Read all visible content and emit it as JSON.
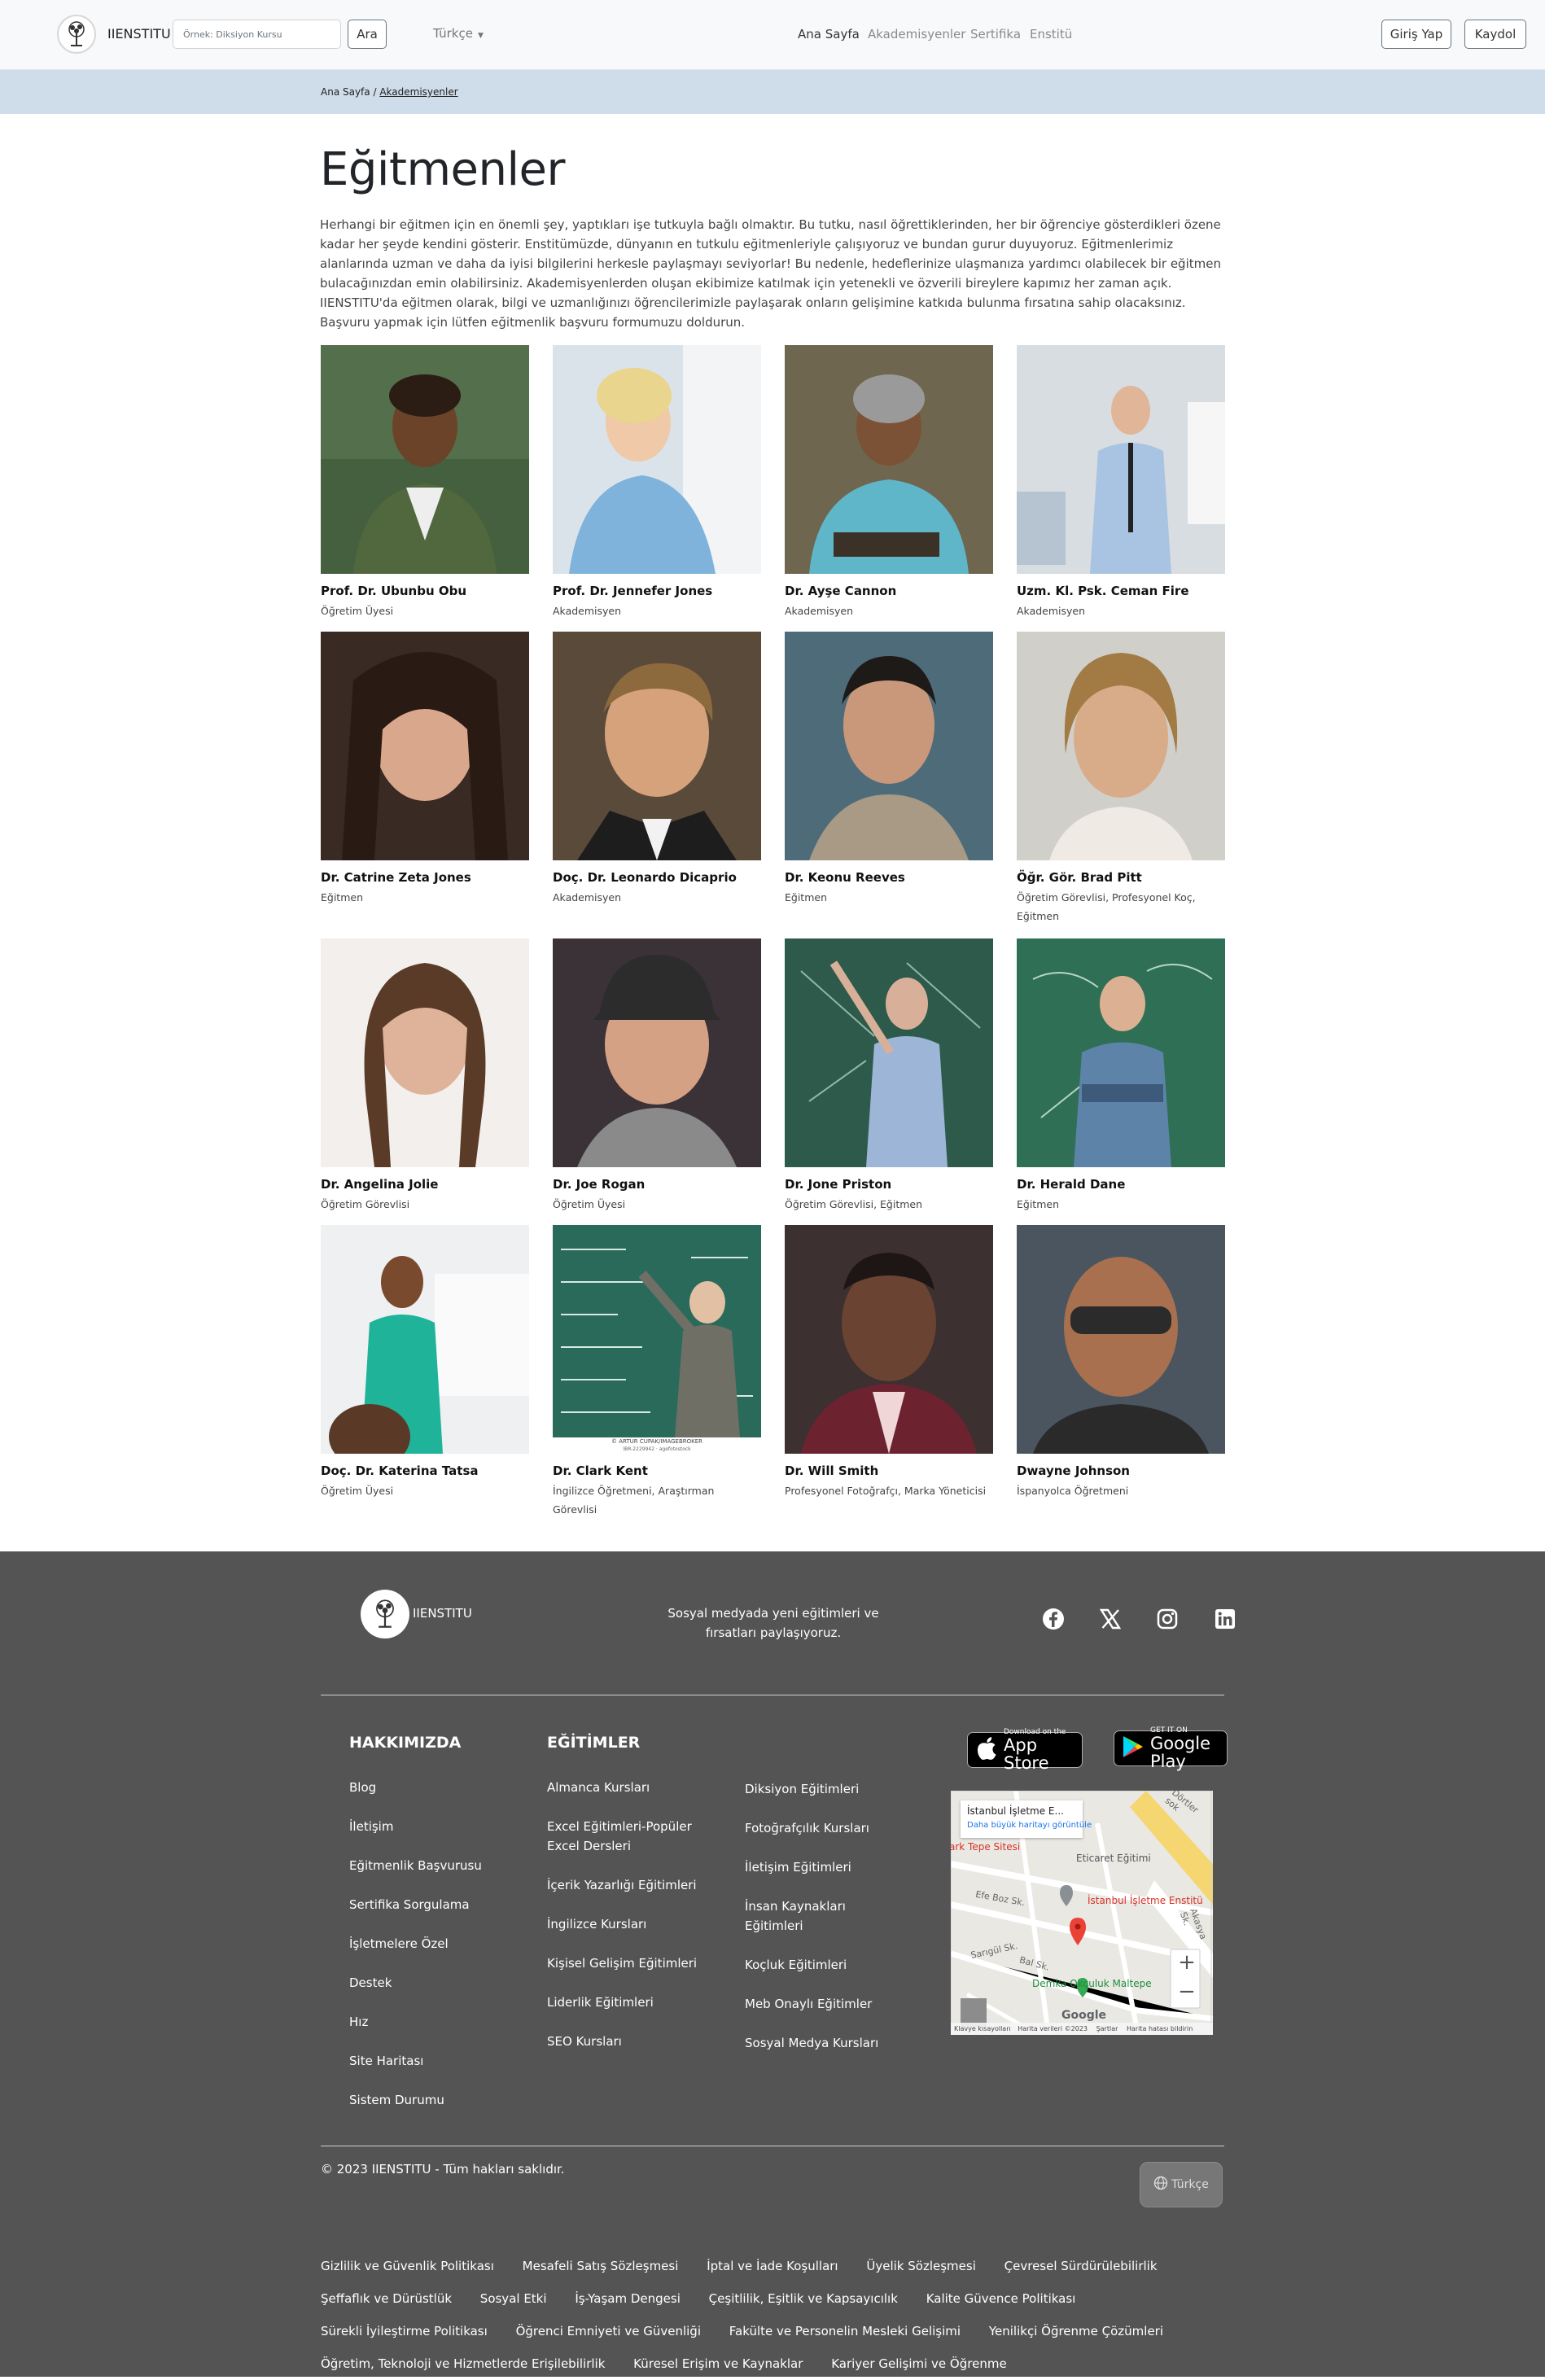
{
  "header": {
    "brand": "IIENSTITU",
    "search_placeholder": "Örnek: Diksiyon Kursu",
    "search_button": "Ara",
    "language": "Türkçe",
    "nav": [
      "Ana Sayfa",
      "Akademisyenler",
      "Sertifika",
      "Enstitü"
    ],
    "login": "Giriş Yap",
    "register": "Kaydol"
  },
  "breadcrumb": {
    "home": "Ana Sayfa",
    "separator": "/",
    "current": "Akademisyenler"
  },
  "page": {
    "title": "Eğitmenler",
    "intro": "Herhangi bir eğitmen için en önemli şey, yaptıkları işe tutkuyla bağlı olmaktır. Bu tutku, nasıl öğrettiklerinden, her bir öğrenciye gösterdikleri özene kadar her şeyde kendini gösterir. Enstitümüzde, dünyanın en tutkulu eğitmenleriyle çalışıyoruz ve bundan gurur duyuyoruz. Eğitmenlerimiz alanlarında uzman ve daha da iyisi bilgilerini herkesle paylaşmayı seviyorlar! Bu nedenle, hedeflerinize ulaşmanıza yardımcı olabilecek bir eğitmen bulacağınızdan emin olabilirsiniz. Akademisyenlerden oluşan ekibimize katılmak için yetenekli ve özverili bireylere kapımız her zaman açık. IIENSTITU'da eğitmen olarak, bilgi ve uzmanlığınızı öğrencilerimizle paylaşarak onların gelişimine katkıda bulunma fırsatına sahip olacaksınız. Başvuru yapmak için lütfen eğitmenlik başvuru formumuzu doldurun."
  },
  "instructors": [
    {
      "name": "Prof. Dr. Ubunbu Obu",
      "role": "Öğretim Üyesi"
    },
    {
      "name": "Prof. Dr. Jennefer Jones",
      "role": "Akademisyen"
    },
    {
      "name": "Dr. Ayşe Cannon",
      "role": "Akademisyen"
    },
    {
      "name": "Uzm. Kl. Psk. Ceman Fire",
      "role": "Akademisyen"
    },
    {
      "name": "Dr. Catrine Zeta Jones",
      "role": "Eğitmen"
    },
    {
      "name": "Doç. Dr. Leonardo Dicaprio",
      "role": "Akademisyen"
    },
    {
      "name": "Dr. Keonu Reeves",
      "role": "Eğitmen"
    },
    {
      "name": "Öğr. Gör. Brad Pitt",
      "role": "Öğretim Görevlisi, Profesyonel Koç, Eğitmen"
    },
    {
      "name": "Dr. Angelina Jolie",
      "role": "Öğretim Görevlisi"
    },
    {
      "name": "Dr. Joe Rogan",
      "role": "Öğretim Üyesi"
    },
    {
      "name": "Dr. Jone Priston",
      "role": "Öğretim Görevlisi, Eğitmen"
    },
    {
      "name": "Dr. Herald Dane",
      "role": "Eğitmen"
    },
    {
      "name": "Doç. Dr. Katerina Tatsa",
      "role": "Öğretim Üyesi"
    },
    {
      "name": "Dr. Clark Kent",
      "role": "İngilizce Öğretmeni, Araştırman Görevlisi"
    },
    {
      "name": "Dr. Will Smith",
      "role": "Profesyonel Fotoğrafçı, Marka Yöneticisi"
    },
    {
      "name": "Dwayne Johnson",
      "role": "İspanyolca Öğretmeni"
    }
  ],
  "photo_credit": {
    "line1": "© ARTUR CUPAK/IMAGEBROKER",
    "line2": "IBR-2229942 · agefotostock"
  },
  "footer": {
    "brand": "IIENSTITU",
    "slogan": "Sosyal medyada yeni eğitimleri ve fırsatları paylaşıyoruz.",
    "social_icons": [
      "facebook-icon",
      "x-icon",
      "instagram-icon",
      "linkedin-icon"
    ],
    "about_title": "HAKKIMIZDA",
    "about_links": [
      "Blog",
      "İletişim",
      "Eğitmenlik Başvurusu",
      "Sertifika Sorgulama",
      "İşletmelere Özel",
      "Destek",
      "Hız",
      "Site Haritası",
      "Sistem Durumu"
    ],
    "trainings_title": "EĞİTİMLER",
    "trainings_col1": [
      "Almanca Kursları",
      "Excel Eğitimleri-Popüler Excel Dersleri",
      "İçerik Yazarlığı Eğitimleri",
      "İngilizce Kursları",
      "Kişisel Gelişim Eğitimleri",
      "Liderlik Eğitimleri",
      "SEO Kursları"
    ],
    "trainings_col2": [
      "Diksiyon Eğitimleri",
      "Fotoğrafçılık Kursları",
      "İletişim Eğitimleri",
      "İnsan Kaynakları Eğitimleri",
      "Koçluk Eğitimleri",
      "Meb Onaylı Eğitimler",
      "Sosyal Medya Kursları"
    ],
    "appstore": {
      "small": "Download on the",
      "big": "App Store"
    },
    "googleplay": {
      "small": "GET IT ON",
      "big": "Google Play"
    },
    "map": {
      "place": "İstanbul İşletme E...",
      "larger_map": "Daha büyük haritayı görüntüle",
      "labels": [
        "Eticaret Eğitimi",
        "İstanbul İşletme Enstitü",
        "Demka Okçuluk Maltepe",
        "ark Tepe Sitesi",
        "Efe Boz Sk.",
        "Sarıgül Sk.",
        "Bal Sk.",
        "Dörtler sok",
        "Akasya Sk."
      ],
      "google": "Google",
      "attribution": [
        "Klavye kısayolları",
        "Harita verileri ©2023",
        "Şartlar",
        "Harita hatası bildirin"
      ],
      "zoom_in": "+",
      "zoom_out": "−"
    },
    "copyright": "© 2023 IIENSTITU - Tüm hakları saklıdır.",
    "lang_button": "Türkçe",
    "legal_links": [
      "Gizlilik ve Güvenlik Politikası",
      "Mesafeli Satış Sözleşmesi",
      "İptal ve İade Koşulları",
      "Üyelik Sözleşmesi",
      "Çevresel Sürdürülebilirlik",
      "Şeffaflık ve Dürüstlük",
      "Sosyal Etki",
      "İş-Yaşam Dengesi",
      "Çeşitlilik, Eşitlik ve Kapsayıcılık",
      "Kalite Güvence Politikası",
      "Sürekli İyileştirme Politikası",
      "Öğrenci Emniyeti ve Güvenliği",
      "Fakülte ve Personelin Mesleki Gelişimi",
      "Yenilikçi Öğrenme Çözümleri",
      "Öğretim, Teknoloji ve Hizmetlerde Erişilebilirlik",
      "Küresel Erişim ve Kaynaklar",
      "Kariyer Gelişimi ve Öğrenme"
    ]
  }
}
